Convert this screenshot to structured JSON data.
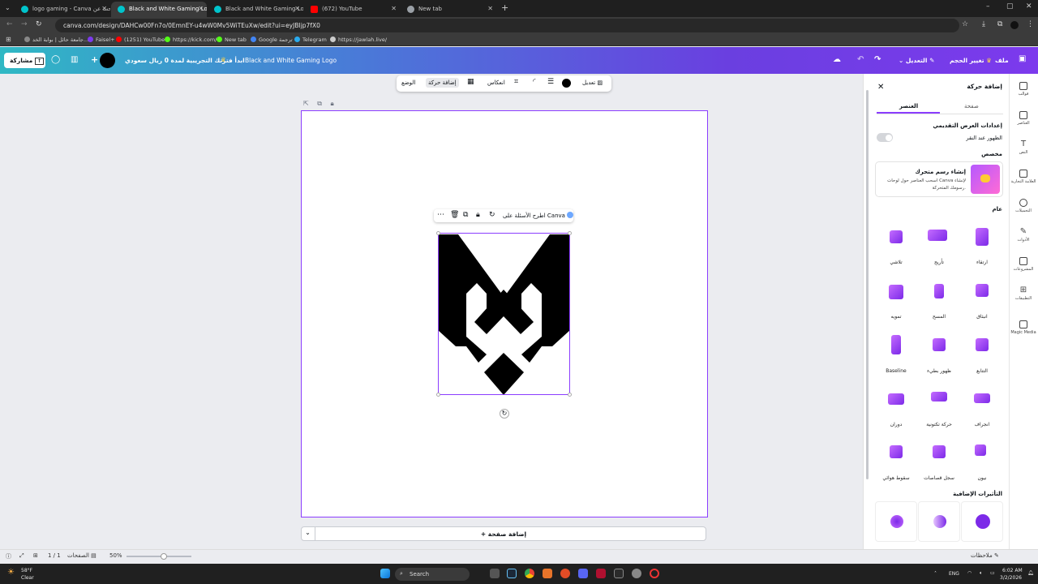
{
  "browser": {
    "tabs": [
      {
        "title": "logo gaming - Canva يبحث عن",
        "active": false,
        "favicon_color": "#00c4cc"
      },
      {
        "title": "Black and White Gaming Logo",
        "active": true,
        "favicon_color": "#00c4cc"
      },
      {
        "title": "Black and White Gaming Logo",
        "active": false,
        "favicon_color": "#00c4cc"
      },
      {
        "title": "(672) YouTube",
        "active": false,
        "favicon_color": "#ff0000"
      },
      {
        "title": "New tab",
        "active": false,
        "favicon_color": "#9aa0a6"
      }
    ],
    "url": "canva.com/design/DAHCw00Fn7o/0EmnEY-u4wW0Mv5WiTEuXw/edit?ui=eyJBIjp7fX0",
    "bookmarks": [
      {
        "label": "جامعة حائل | بوابة الخد...",
        "color": "#888888"
      },
      {
        "label": "Faisel+",
        "color": "#7c3aed"
      },
      {
        "label": "(1251) YouTube",
        "color": "#ff0000"
      },
      {
        "label": "https://kick.com/",
        "color": "#53fc18"
      },
      {
        "label": "New tab",
        "color": "#53fc18"
      },
      {
        "label": "Google ترجمة",
        "color": "#4285f4"
      },
      {
        "label": "Telegram",
        "color": "#2aabee"
      },
      {
        "label": "https://jawlah.live/",
        "color": "#cccccc"
      }
    ]
  },
  "header": {
    "share_label": "مشاركة",
    "trial_label": "ابدأ فترتك التجريبية لمدة 0 ريال سعودي",
    "design_title": "Black and White Gaming Logo",
    "edit_label": "التعديل",
    "resize_label": "تغيير الحجم",
    "file_label": "ملف"
  },
  "context_toolbar": {
    "position_label": "الوضع",
    "animate_label": "إضافة حركة",
    "flip_label": "انعكاس",
    "edit_label": "تعديل"
  },
  "element_toolbar": {
    "ask_label": "اطرح الأسئلة على Canva"
  },
  "canvas": {
    "add_page_label": "+ إضافة صفحة"
  },
  "panel": {
    "title": "إضافة حركة",
    "tabs": [
      "صفحة",
      "العنصر"
    ],
    "active_tab": "العنصر",
    "presentation_heading": "إعدادات العرض التقديمي",
    "appear_on_click_label": "الظهور عند النقر",
    "appear_on_click_enabled": false,
    "custom_heading": "مخصص",
    "create_anim_title": "إنشاء رسم متحرك",
    "create_anim_desc": "اسحب العناصر حول لوحات Canva لإنشاء رسومك المتحركة.",
    "general_heading": "عام",
    "animations": [
      {
        "label": "ارتقاء"
      },
      {
        "label": "تأريج"
      },
      {
        "label": "تلاشي"
      },
      {
        "label": "انبثاق"
      },
      {
        "label": "المسح"
      },
      {
        "label": "تمويه"
      },
      {
        "label": "التتابع"
      },
      {
        "label": "ظهور بطيء"
      },
      {
        "label": "Baseline"
      },
      {
        "label": "انجراف"
      },
      {
        "label": "حركة تكتونية"
      },
      {
        "label": "دوران"
      },
      {
        "label": "نيون"
      },
      {
        "label": "سجل قصاصات"
      },
      {
        "label": "سقوط هوائي"
      }
    ],
    "extra_effects_heading": "التأثيرات الإضافية"
  },
  "rail": [
    {
      "label": "قوالب",
      "icon": "templates-icon"
    },
    {
      "label": "العناصر",
      "icon": "elements-icon"
    },
    {
      "label": "النص",
      "icon": "text-icon"
    },
    {
      "label": "العلامة التجارية",
      "icon": "brand-icon"
    },
    {
      "label": "التحميلات",
      "icon": "uploads-icon"
    },
    {
      "label": "الأدوات",
      "icon": "tools-icon"
    },
    {
      "label": "المشروعات",
      "icon": "projects-icon"
    },
    {
      "label": "التطبيقات",
      "icon": "apps-icon"
    },
    {
      "label": "Magic Media",
      "icon": "magic-media-icon"
    }
  ],
  "status": {
    "notes_label": "ملاحظات",
    "zoom": "50%",
    "zoom_fraction": 0.5,
    "pages_label": "الصفحات",
    "page_count": "1 / 1"
  },
  "taskbar": {
    "weather_temp": "58°F",
    "weather_desc": "Clear",
    "search_placeholder": "Search",
    "lang": "ENG",
    "time": "6:02 AM",
    "date": "3/2/2026"
  },
  "colors": {
    "accent": "#8b3dff",
    "header_start": "#2fb8c4",
    "header_end": "#7c3aed"
  }
}
